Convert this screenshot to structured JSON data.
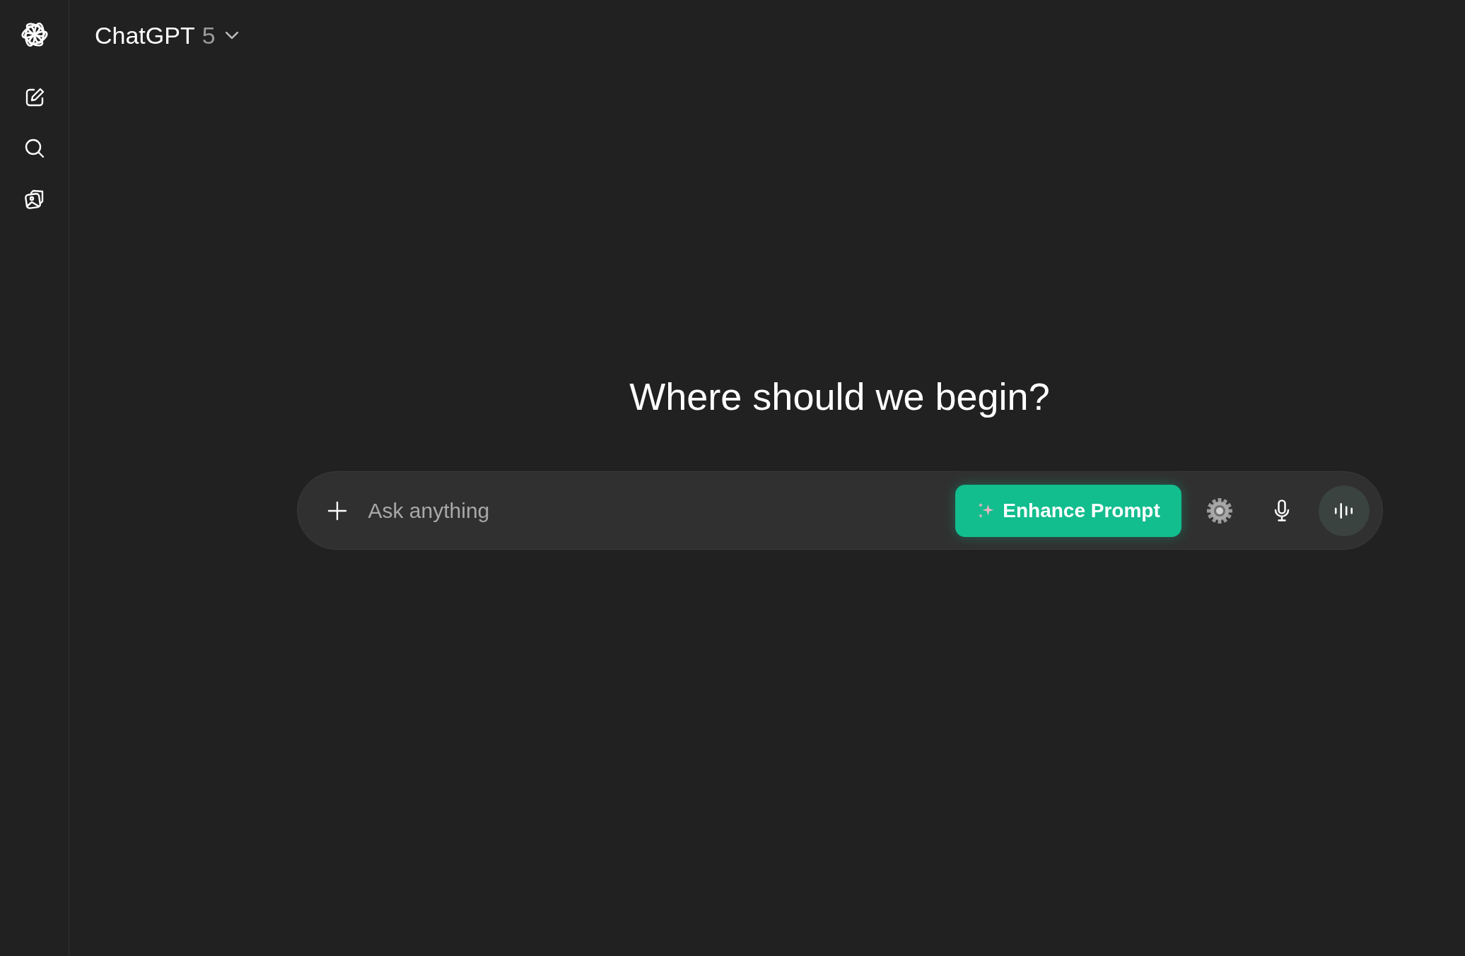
{
  "header": {
    "title": "ChatGPT",
    "version": "5"
  },
  "heading": "Where should we begin?",
  "composer": {
    "placeholder": "Ask anything",
    "enhance_button": "Enhance Prompt"
  }
}
